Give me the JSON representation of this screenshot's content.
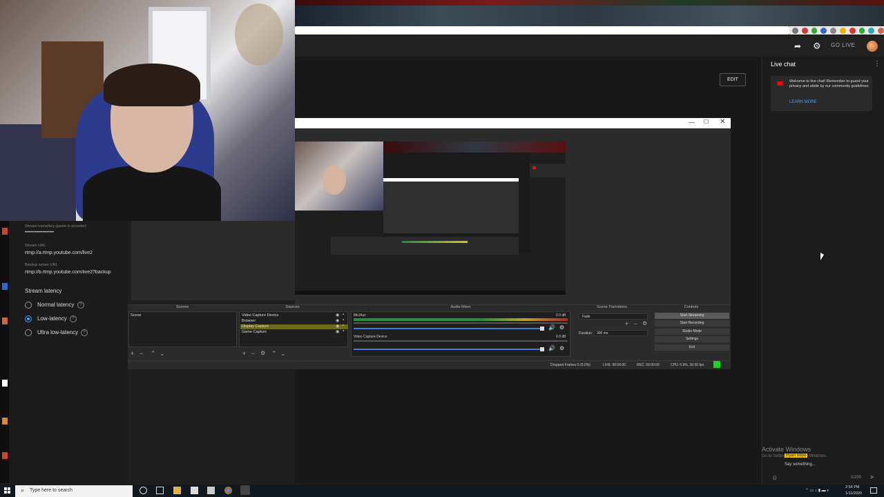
{
  "browser": {
    "go_live": "GO LIVE",
    "edit_label": "EDIT"
  },
  "chat": {
    "title": "Live chat",
    "welcome": "Welcome to live chat! Remember to guard your privacy and abide by our community guidelines.",
    "learn_more": "LEARN MORE",
    "activate_windows": "Activate Windows",
    "activate_sub": "Go to Settings to activate Windows.",
    "user_name": "Ryan Stipo",
    "input_placeholder": "Say something...",
    "char_count": "0/200"
  },
  "stream_settings": {
    "stream_key_label": "Stream name/key (paste in encoder)",
    "stream_key_value": "••••••••••••••••••••",
    "stream_url_label": "Stream URL",
    "stream_url": "rtmp://a.rtmp.youtube.com/live2",
    "backup_url_label": "Backup server URL",
    "backup_url": "rtmp://b.rtmp.youtube.com/live2?backup",
    "latency_heading": "Stream latency",
    "latency_options": [
      {
        "label": "Normal latency",
        "selected": false
      },
      {
        "label": "Low-latency",
        "selected": true
      },
      {
        "label": "Ultra low-latency",
        "selected": false
      }
    ]
  },
  "obs": {
    "docks": {
      "scenes_title": "Scenes",
      "sources_title": "Sources",
      "mixer_title": "Audio Mixer",
      "transitions_title": "Scene Transitions",
      "controls_title": "Controls"
    },
    "scenes": [
      "Scene"
    ],
    "sources": [
      "Video Capture Device",
      "Browser",
      "Display Capture",
      "Game Capture"
    ],
    "mixer": [
      {
        "name": "Mic/Aux",
        "db": "0.0 dB"
      },
      {
        "name": "Video Capture Device",
        "db": "0.0 dB"
      }
    ],
    "transition": {
      "type": "Fade",
      "duration_label": "Duration",
      "duration": "300 ms"
    },
    "controls": [
      "Start Streaming",
      "Start Recording",
      "Studio Mode",
      "Settings",
      "Exit"
    ],
    "status": {
      "dropped": "Dropped Frames 0 (0.0%)",
      "live": "LIVE: 00:00:00",
      "rec": "REC: 00:00:00",
      "cpu": "CPU: 0.9%, 30.00 fps"
    },
    "colors": {
      "status_led": "#1ed31e",
      "selected_source": "#6a6a1a"
    }
  },
  "taskbar": {
    "search_placeholder": "Type here to search",
    "time": "2:54 PM",
    "date": "1/11/2020"
  }
}
